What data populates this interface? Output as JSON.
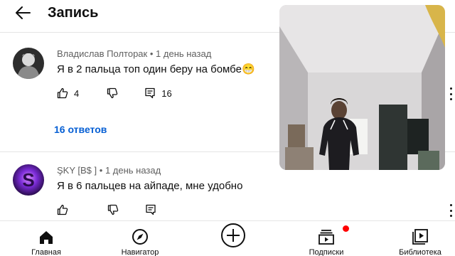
{
  "header": {
    "title": "Запись"
  },
  "comments": [
    {
      "author": "Владислав Полторак",
      "time": "1 день назад",
      "text": "Я в 2 пальца топ один беру на бомбе😁",
      "likes": "4",
      "replies_count": "16",
      "replies_link": "16 ответов"
    },
    {
      "author": "ŞKY [B$ ]",
      "time": "1 день назад",
      "text": "Я в 6 пальцев на айпаде, мне удобно"
    }
  ],
  "bottom_nav": [
    {
      "label": "Главная",
      "icon": "home-icon"
    },
    {
      "label": "Навигатор",
      "icon": "compass-icon"
    },
    {
      "label": "",
      "icon": "create-icon"
    },
    {
      "label": "Подписки",
      "icon": "subscriptions-icon"
    },
    {
      "label": "Библиотека",
      "icon": "library-icon"
    }
  ],
  "colors": {
    "link": "#065fd4",
    "badge": "#ff0000",
    "meta_text": "#606060"
  }
}
